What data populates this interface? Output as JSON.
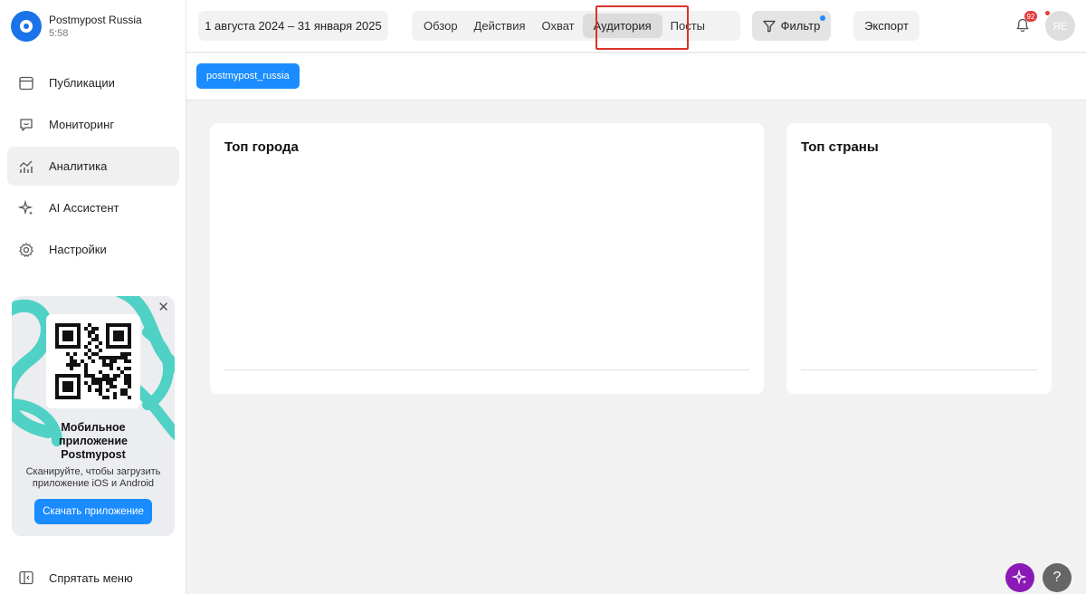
{
  "account": {
    "name": "Postmypost Russia",
    "time": "5:58"
  },
  "sidebar": {
    "items": [
      {
        "label": "Публикации",
        "icon": "calendar-icon"
      },
      {
        "label": "Мониторинг",
        "icon": "chat-icon"
      },
      {
        "label": "Аналитика",
        "icon": "analytics-icon",
        "active": true
      },
      {
        "label": "AI Ассистент",
        "icon": "sparkle-icon"
      },
      {
        "label": "Настройки",
        "icon": "gear-icon"
      }
    ],
    "hide_menu": "Спрятать меню"
  },
  "promo": {
    "title_line1": "Мобильное",
    "title_line2": "приложение",
    "title_line3": "Postmypost",
    "desc_line1": "Сканируйте, чтобы загрузить",
    "desc_line2": "приложение iOS и Android",
    "button": "Скачать приложение",
    "accent": "#4fd1c5"
  },
  "topbar": {
    "date_range": "1 августа 2024 – 31 января 2025",
    "tabs": [
      "Обзор",
      "Действия",
      "Охват",
      "Аудитория",
      "Посты"
    ],
    "active_tab": "Аудитория",
    "filter": "Фильтр",
    "export": "Экспорт",
    "notifications_count": "92",
    "avatar_initials": "ЯЕ"
  },
  "chip": {
    "label": "postmypost_russia",
    "color": "#1a8cff"
  },
  "cards": {
    "cities": {
      "title": "Топ города"
    },
    "countries": {
      "title": "Топ страны"
    }
  },
  "colors": {
    "highlight": "#d9342b",
    "ai_fab": "#8a19b5"
  }
}
